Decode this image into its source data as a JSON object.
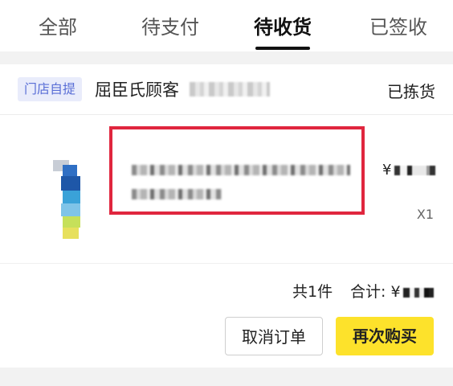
{
  "tabs": [
    {
      "label": "全部",
      "active": false
    },
    {
      "label": "待支付",
      "active": false
    },
    {
      "label": "待收货",
      "active": true
    },
    {
      "label": "已签收",
      "active": false
    }
  ],
  "order": {
    "pickup_badge": "门店自提",
    "customer_label": "屈臣氏顾客",
    "status": "已拣货"
  },
  "product": {
    "price_prefix": "¥",
    "quantity": "X1"
  },
  "summary": {
    "count_text": "共1件",
    "total_label": "合计: ¥"
  },
  "actions": {
    "cancel_label": "取消订单",
    "rebuy_label": "再次购买"
  },
  "colors": {
    "highlight_border": "#e0263e",
    "rebuy_button": "#fde22b",
    "badge_bg": "#e9ecfb",
    "badge_text": "#5a6fd6"
  }
}
